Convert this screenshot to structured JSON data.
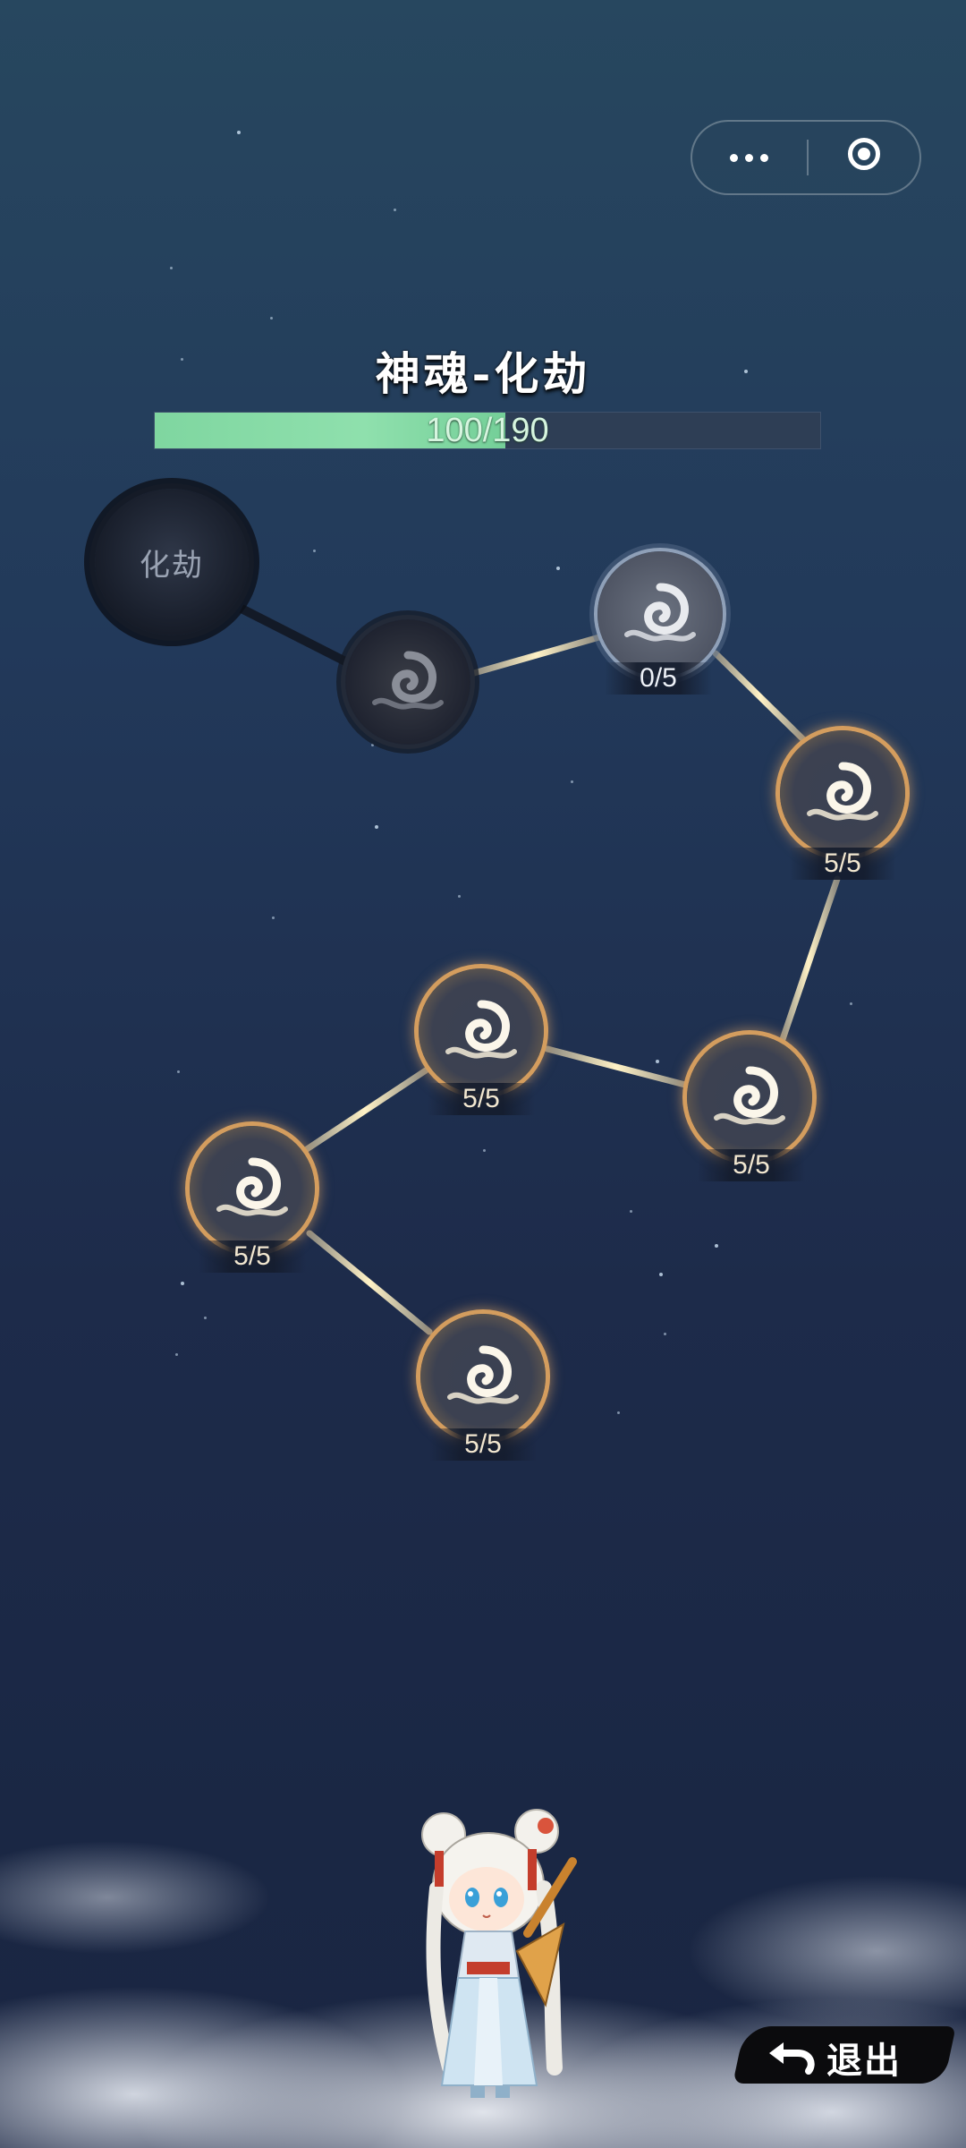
{
  "title": "神魂-化劫",
  "progress": {
    "current": 100,
    "max": 190,
    "text": "100/190",
    "fill_color": "#7fd6a0"
  },
  "start_node": {
    "label": "化劫"
  },
  "nodes": [
    {
      "state": "locked",
      "count": ""
    },
    {
      "state": "available",
      "count": "0/5"
    },
    {
      "state": "completed",
      "count": "5/5"
    },
    {
      "state": "completed",
      "count": "5/5"
    },
    {
      "state": "completed",
      "count": "5/5"
    },
    {
      "state": "completed",
      "count": "5/5"
    },
    {
      "state": "completed",
      "count": "5/5"
    }
  ],
  "node_icon": "spiral-cloud-icon",
  "exit_button": {
    "label": "退出",
    "icon": "return-arrow-icon"
  },
  "capsule": {
    "more_icon": "more-dots-icon",
    "close_icon": "target-circle-icon"
  },
  "colors": {
    "completed_ring": "#d49d5e",
    "link_glow": "#f0dca8",
    "background_top": "#27475f",
    "background_bottom": "#1b2642"
  }
}
